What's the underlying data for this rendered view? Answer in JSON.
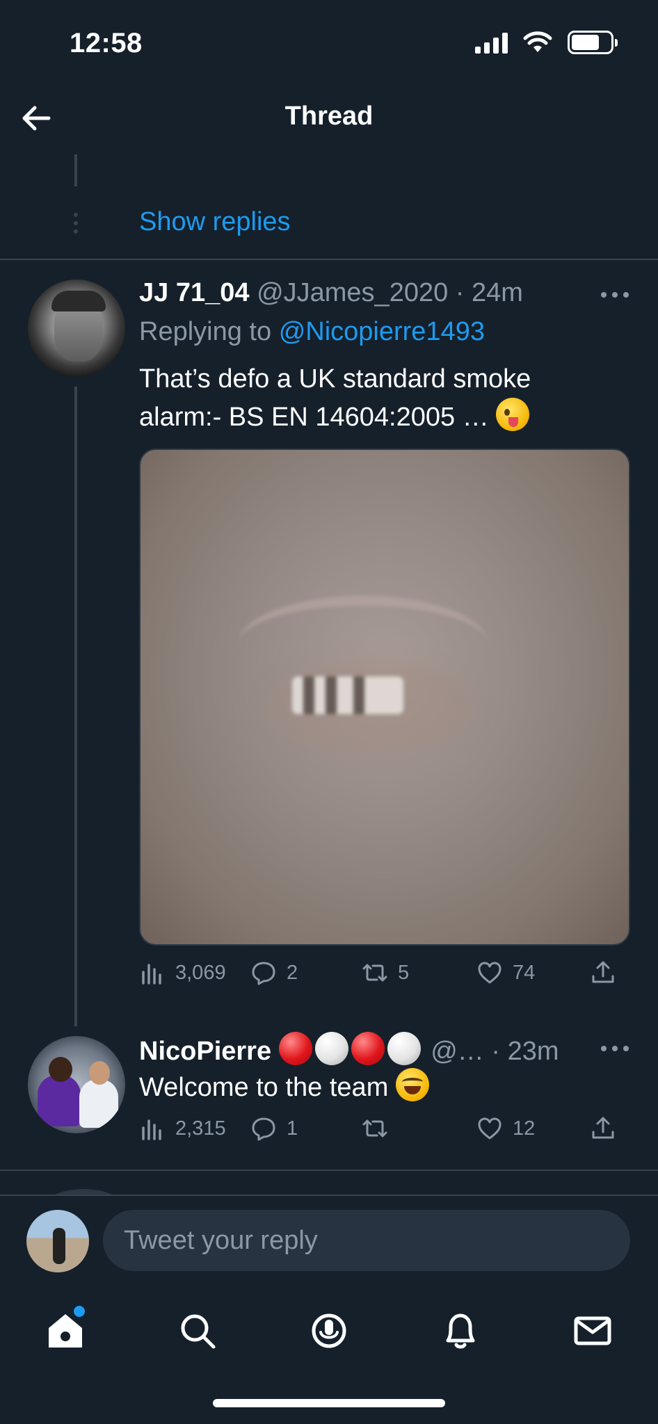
{
  "status_bar": {
    "time": "12:58"
  },
  "header": {
    "title": "Thread"
  },
  "show_replies": "Show replies",
  "tweets": [
    {
      "display_name": "JJ 71_04",
      "handle": "@JJames_2020",
      "separator": "·",
      "time": "24m",
      "replying_prefix": "Replying to",
      "replying_to": "@Nicopierre1493",
      "text_line1": "That’s defo a UK standard smoke",
      "text_line2": "alarm:- BS EN 14604:2005 …",
      "emoji": "winking-face-with-tongue",
      "has_media": true,
      "stats": {
        "views": "3,069",
        "replies": "2",
        "retweets": "5",
        "likes": "74"
      }
    },
    {
      "display_name": "NicoPierre",
      "name_emojis": [
        "red-circle",
        "white-circle",
        "red-circle",
        "white-circle"
      ],
      "handle": "@…",
      "separator": "·",
      "time": "23m",
      "text": "Welcome to the team",
      "emoji": "grinning-squinting-face",
      "stats": {
        "views": "2,315",
        "replies": "1",
        "retweets": "",
        "likes": "12"
      }
    }
  ],
  "reply_bar": {
    "placeholder": "Tweet your reply"
  },
  "tab_bar": {
    "items": [
      "home-icon",
      "search-icon",
      "spaces-icon",
      "notifications-icon",
      "messages-icon"
    ],
    "active": "home-icon",
    "home_has_dot": true
  },
  "colors": {
    "background": "#15202b",
    "accent": "#1d9bf0",
    "muted": "#8b98a5",
    "divider": "#38444d"
  }
}
